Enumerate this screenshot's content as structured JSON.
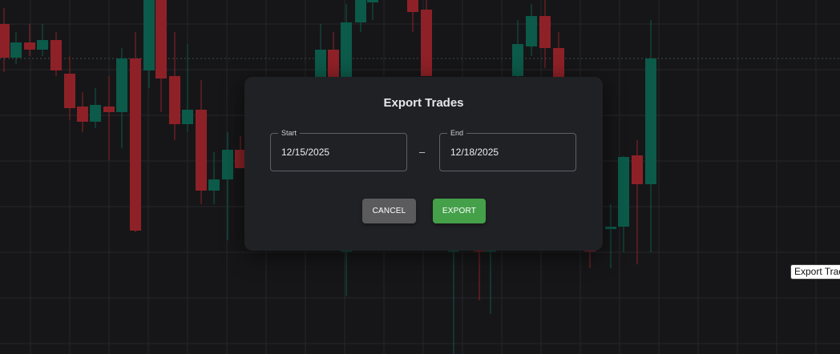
{
  "colors": {
    "background": "#161618",
    "grid": "#26272b",
    "bull": "#0c5a49",
    "bear": "#8e2127",
    "dialog_bg": "#202125",
    "export_button": "#45a04a",
    "cancel_button": "#5b5b5d"
  },
  "dialog": {
    "title": "Export Trades",
    "start": {
      "label": "Start",
      "value": "12/15/2025"
    },
    "separator": "–",
    "end": {
      "label": "End",
      "value": "12/18/2025"
    },
    "cancel_label": "CANCEL",
    "export_label": "EXPORT"
  },
  "tooltip": {
    "text": "Export Trades"
  }
}
